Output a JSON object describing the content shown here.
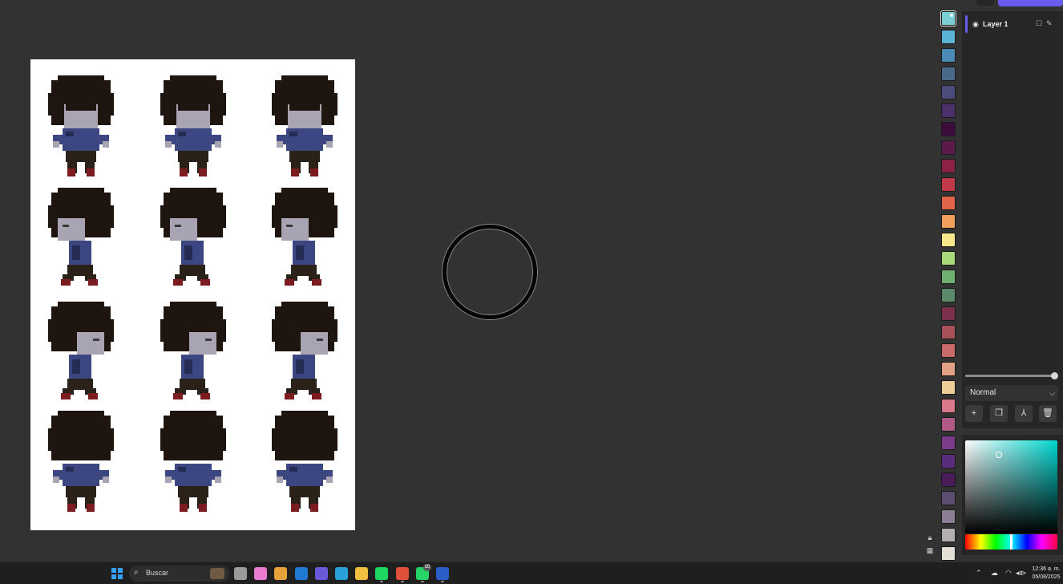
{
  "layers_panel": {
    "layers": [
      {
        "name": "Layer 1",
        "visible": true,
        "locked": false
      }
    ],
    "opacity": 1.0,
    "blend_mode": "Normal",
    "actions": [
      "add-layer",
      "duplicate-layer",
      "merge-down",
      "delete-layer"
    ]
  },
  "palette": {
    "selected_index": 0,
    "colors": [
      "#7ad0d4",
      "#5cb2d2",
      "#4a8ab4",
      "#4a6a8c",
      "#4c4c7c",
      "#4a2f6a",
      "#3c0c3c",
      "#5c1a4a",
      "#8a2248",
      "#c23a4a",
      "#e0644a",
      "#f0a05a",
      "#f8e88c",
      "#a8d878",
      "#70b070",
      "#5a8a6a",
      "#7a2f4c",
      "#a8505a",
      "#c86a6a",
      "#e2a084",
      "#eecc98",
      "#d87a8a",
      "#b05a8a",
      "#7c3c8a",
      "#5a2c7c",
      "#4a1c5a",
      "#5c4c70",
      "#8c7c94",
      "#b4aeb0",
      "#e4e0d6"
    ]
  },
  "canvas": {
    "background": "#ffffff",
    "sprite_colors": {
      "hair": "#1e160e",
      "skin": "#a8a4b4",
      "shirt": "#3c4680",
      "shirt_dark": "#252c54",
      "pants": "#2a2218",
      "shoes": "#7c1c20"
    }
  },
  "tools": {
    "lock_icon": "lock-icon",
    "grid_icon": "grid-icon"
  },
  "color_picker": {
    "hue_color": "#00d6d0"
  },
  "taskbar": {
    "search_placeholder": "Buscar",
    "apps": [
      {
        "name": "task-view",
        "color": "#9a9a9a"
      },
      {
        "name": "copilot",
        "color": "#e87ad0"
      },
      {
        "name": "calendar",
        "color": "#e8a23a"
      },
      {
        "name": "outlook",
        "color": "#1f7ad0"
      },
      {
        "name": "teams",
        "color": "#6a5ad8"
      },
      {
        "name": "edge",
        "color": "#2aa0d8"
      },
      {
        "name": "file-explorer",
        "color": "#f0c040"
      },
      {
        "name": "spotify",
        "color": "#1ed760"
      },
      {
        "name": "chrome",
        "color": "#e0503a"
      },
      {
        "name": "whatsapp",
        "color": "#25d366",
        "badge": "10"
      },
      {
        "name": "word",
        "color": "#2b5cc8"
      }
    ],
    "time": "12:36 a. m.",
    "date": "05/08/2025"
  }
}
